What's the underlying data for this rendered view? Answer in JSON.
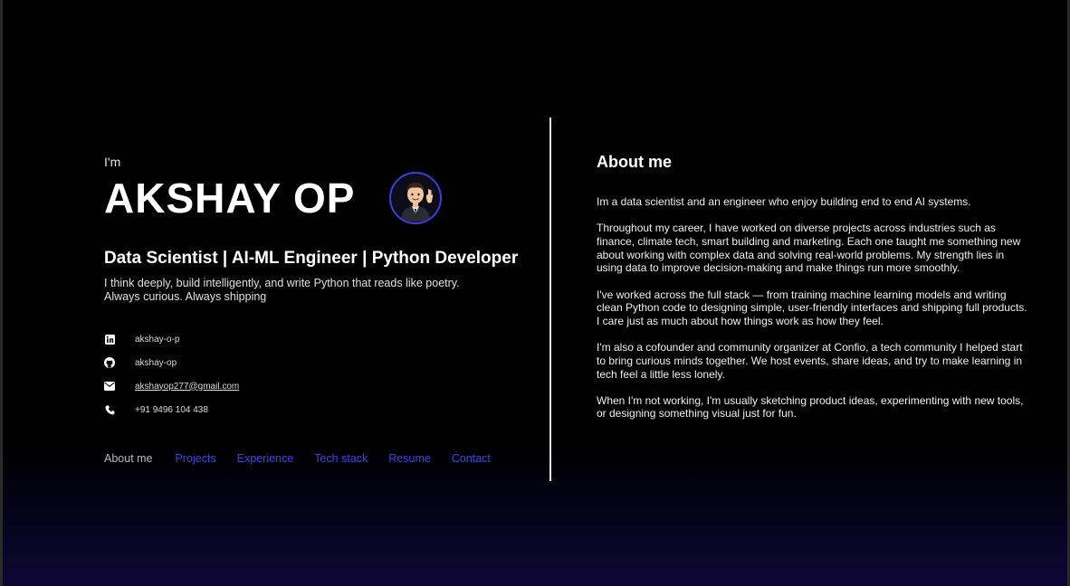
{
  "hero": {
    "greeting": "I'm",
    "name": "AKSHAY OP",
    "role": "Data Scientist | AI-ML Engineer | Python Developer",
    "tagline_line1": "I think deeply, build intelligently, and write Python that reads like poetry.",
    "tagline_line2": "Always curious. Always shipping"
  },
  "contacts": [
    {
      "icon": "linkedin-icon",
      "text": "akshay-o-p"
    },
    {
      "icon": "github-icon",
      "text": "akshay-op"
    },
    {
      "icon": "mail-icon",
      "text": "akshayop277@gmail.com"
    },
    {
      "icon": "phone-icon",
      "text": "+91 9496 104 438"
    }
  ],
  "nav": [
    {
      "label": "About me",
      "active": true
    },
    {
      "label": "Projects"
    },
    {
      "label": "Experience"
    },
    {
      "label": "Tech stack"
    },
    {
      "label": "Resume"
    },
    {
      "label": "Contact"
    }
  ],
  "about": {
    "title": "About me",
    "paragraphs": [
      "Im a data scientist and an engineer who enjoy building end to end AI systems.",
      "Throughout my career, I have worked on diverse projects across industries such as finance, climate  tech, smart building  and marketing. Each one taught me something new about working with complex data and solving real-world problems. My strength lies in using data to improve decision-making and make things run more smoothly.",
      "I've worked across the full stack — from training machine learning models and writing clean Python code to designing simple, user-friendly interfaces and shipping full products. I care just as much about how things work as how they feel.",
      "I'm also a cofounder and community organizer at Confio, a tech community I helped start to bring curious minds together. We host events, share ideas, and try to make learning in tech feel a little less lonely.",
      "When I'm not working, I'm usually sketching product ideas, experimenting with new tools, or designing something visual just for fun."
    ]
  },
  "colors": {
    "accent": "#3b45e0",
    "background": "#000000",
    "gradient_bottom": "#0e0736"
  }
}
